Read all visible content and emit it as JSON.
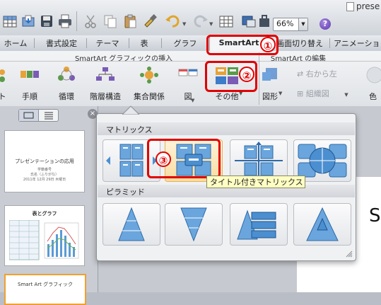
{
  "toolbar": {
    "zoom": "66%",
    "doc_title": "prese",
    "help": "?"
  },
  "tabs": [
    "ホーム",
    "書式設定",
    "テーマ",
    "表",
    "グラフ",
    "SmartArt",
    "画面切り替え",
    "アニメーショ"
  ],
  "ribbon": {
    "group_insert": "SmartArt グラフィックの挿入",
    "group_edit": "SmartArt の編集",
    "buttons": [
      "ト",
      "手順",
      "循環",
      "階層構造",
      "集合関係",
      "図",
      "その他",
      "図形"
    ],
    "right_to_left": "右から左",
    "org_chart": "組織図",
    "color_partial": "色"
  },
  "left_panel": {
    "slides": [
      {
        "title": "プレゼンテーションの応用",
        "sub1": "学籍番号",
        "sub2": "氏名（ふりがな）",
        "sub3": "2011年 12月 29日 木曜日"
      },
      {
        "title": "表とグラフ"
      },
      {
        "title": "Smart Art グラフィック"
      }
    ]
  },
  "canvas": {
    "slide_text": "Sr"
  },
  "gallery": {
    "section1": "マトリックス",
    "section2": "ピラミッド",
    "tooltip": "タイトル付きマトリックス"
  },
  "annotations": [
    "①",
    "②",
    "③"
  ],
  "colors": {
    "annotation_red": "#e00000",
    "tile_blue": "#5b9bd5"
  }
}
